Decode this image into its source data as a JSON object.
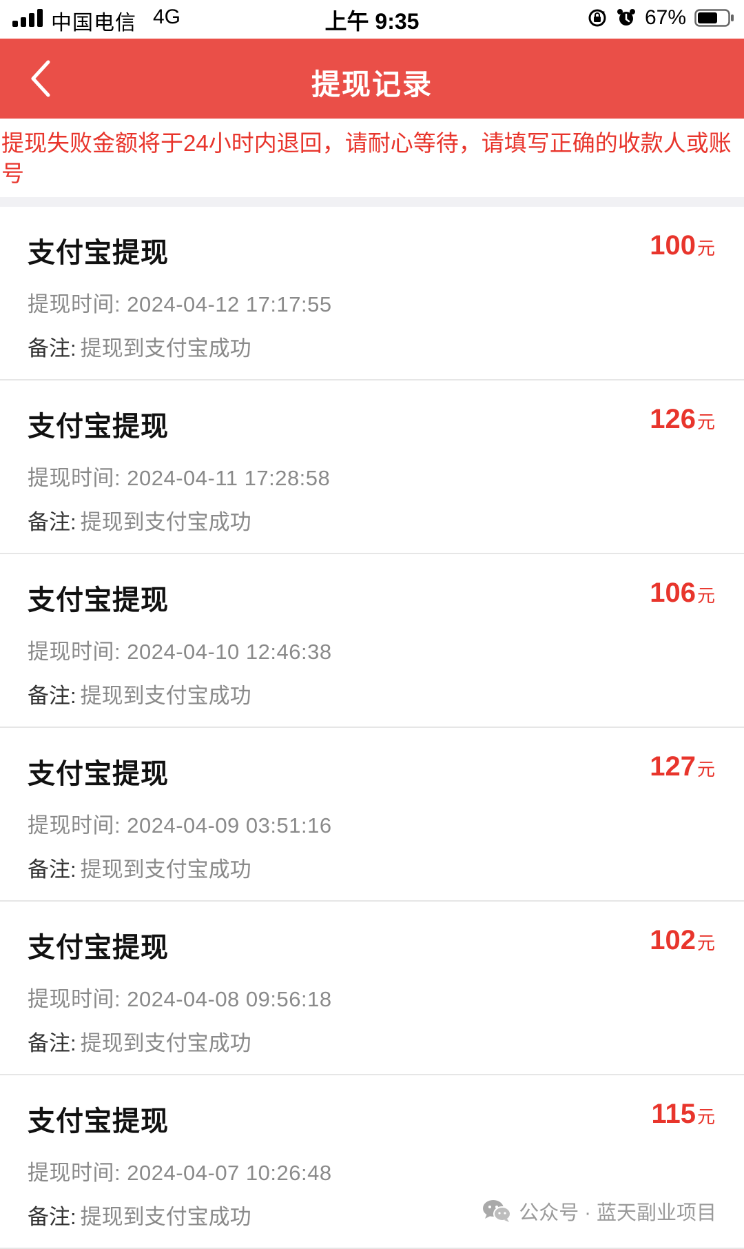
{
  "status_bar": {
    "carrier": "中国电信",
    "network": "4G",
    "time": "上午 9:35",
    "battery_percent": "67%",
    "battery_level": 0.67
  },
  "nav": {
    "title": "提现记录"
  },
  "notice": {
    "text": "提现失败金额将于24小时内退回，请耐心等待，请填写正确的收款人或账号",
    "color": "#e8352c"
  },
  "theme": {
    "brand": "#ea4f48",
    "amount_color": "#e8352c"
  },
  "records": [
    {
      "title": "支付宝提现",
      "amount": "100",
      "unit": "元",
      "time": "提现时间: 2024-04-12 17:17:55",
      "note_label": "备注:",
      "note": "提现到支付宝成功"
    },
    {
      "title": "支付宝提现",
      "amount": "126",
      "unit": "元",
      "time": "提现时间: 2024-04-11 17:28:58",
      "note_label": "备注:",
      "note": "提现到支付宝成功"
    },
    {
      "title": "支付宝提现",
      "amount": "106",
      "unit": "元",
      "time": "提现时间: 2024-04-10 12:46:38",
      "note_label": "备注:",
      "note": "提现到支付宝成功"
    },
    {
      "title": "支付宝提现",
      "amount": "127",
      "unit": "元",
      "time": "提现时间: 2024-04-09 03:51:16",
      "note_label": "备注:",
      "note": "提现到支付宝成功"
    },
    {
      "title": "支付宝提现",
      "amount": "102",
      "unit": "元",
      "time": "提现时间: 2024-04-08 09:56:18",
      "note_label": "备注:",
      "note": "提现到支付宝成功"
    },
    {
      "title": "支付宝提现",
      "amount": "115",
      "unit": "元",
      "time": "提现时间: 2024-04-07 10:26:48",
      "note_label": "备注:",
      "note": "提现到支付宝成功"
    }
  ],
  "watermark": {
    "text": "公众号 · 蓝天副业项目",
    "icon": "wechat-icon"
  }
}
